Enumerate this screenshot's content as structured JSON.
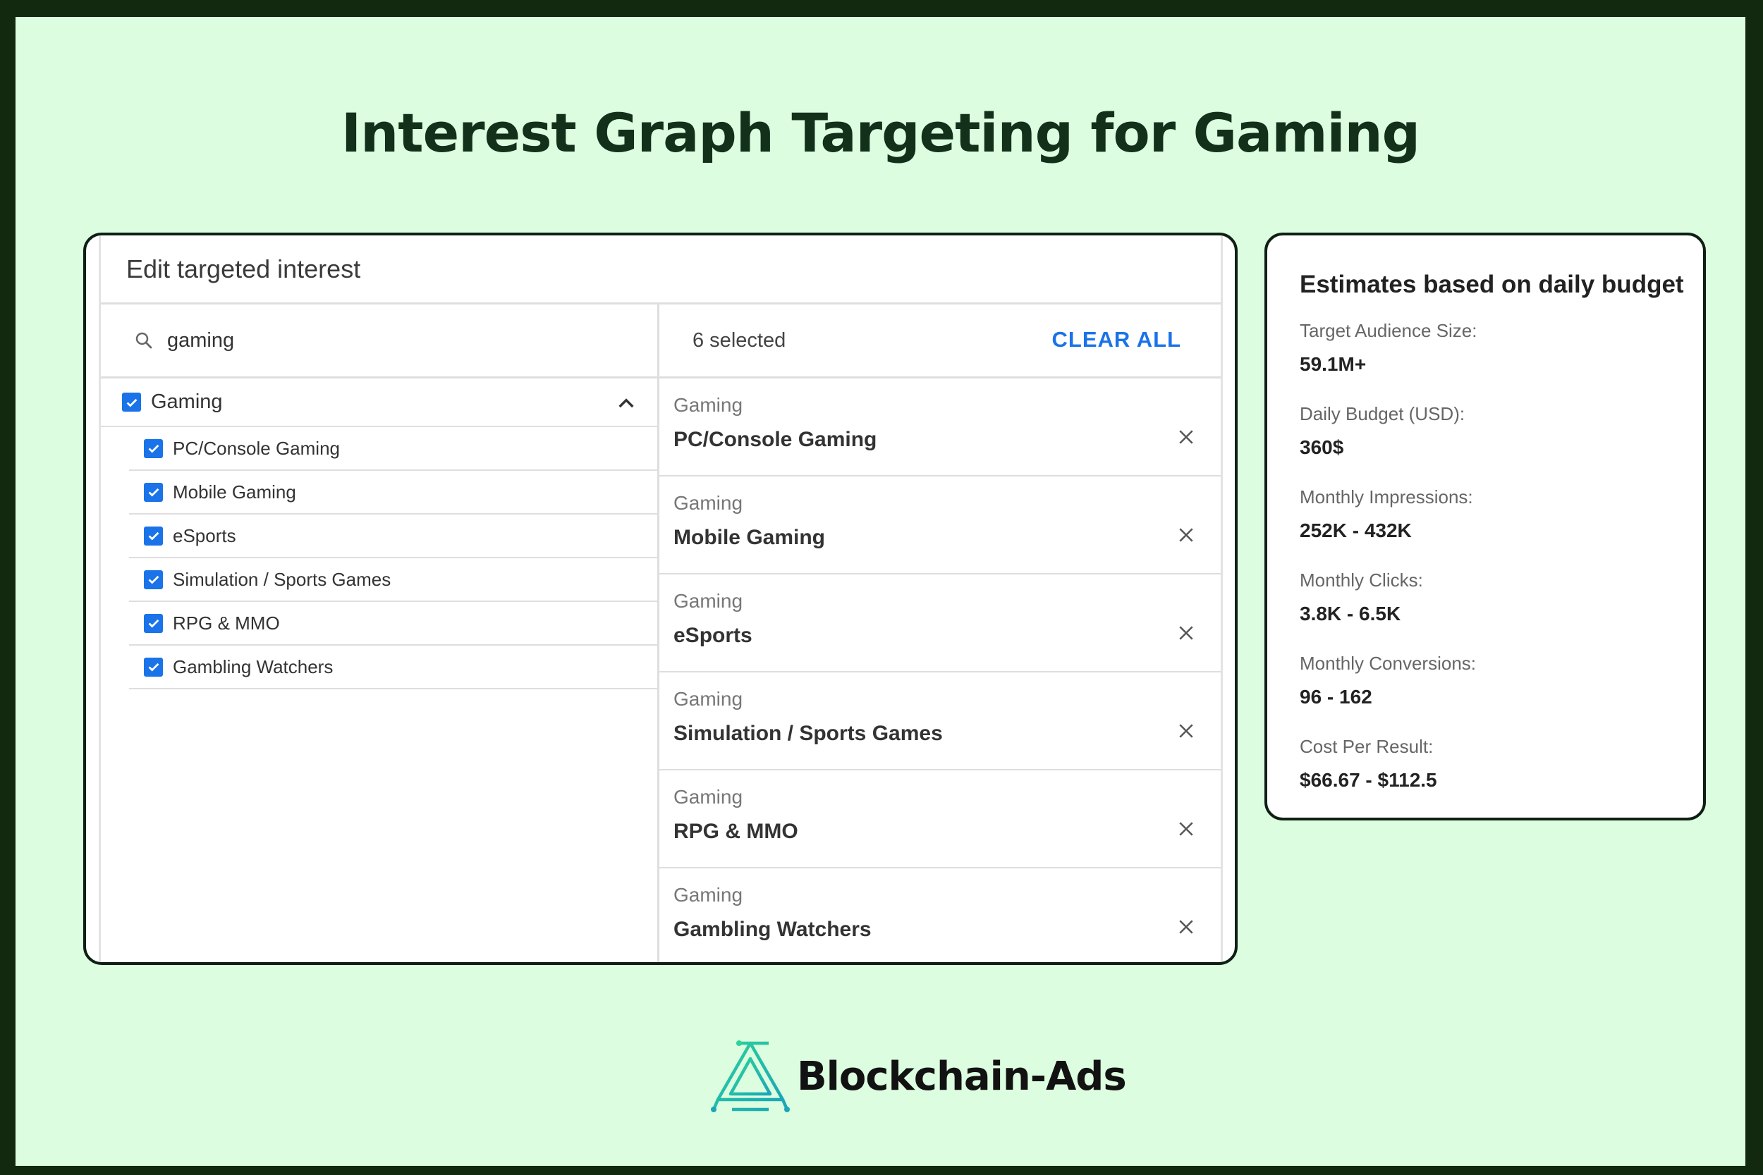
{
  "title": "Interest Graph Targeting for Gaming",
  "panel": {
    "header": "Edit targeted interest",
    "search": {
      "value": "gaming",
      "icon": "search-icon"
    },
    "tree": {
      "parent": {
        "label": "Gaming",
        "checked": true,
        "expanded": true
      },
      "children": [
        {
          "label": "PC/Console Gaming",
          "checked": true
        },
        {
          "label": "Mobile Gaming",
          "checked": true
        },
        {
          "label": "eSports",
          "checked": true
        },
        {
          "label": "Simulation / Sports Games",
          "checked": true
        },
        {
          "label": "RPG & MMO",
          "checked": true
        },
        {
          "label": "Gambling Watchers",
          "checked": true
        }
      ]
    },
    "selected": {
      "count_label": "6 selected",
      "clear_label": "CLEAR ALL",
      "items": [
        {
          "category": "Gaming",
          "name": "PC/Console Gaming"
        },
        {
          "category": "Gaming",
          "name": "Mobile Gaming"
        },
        {
          "category": "Gaming",
          "name": "eSports"
        },
        {
          "category": "Gaming",
          "name": "Simulation / Sports Games"
        },
        {
          "category": "Gaming",
          "name": "RPG & MMO"
        },
        {
          "category": "Gaming",
          "name": "Gambling Watchers"
        }
      ]
    }
  },
  "estimates": {
    "title": "Estimates based on daily budget",
    "stats": [
      {
        "label": "Target Audience Size:",
        "value": "59.1M+"
      },
      {
        "label": "Daily Budget (USD):",
        "value": "360$"
      },
      {
        "label": "Monthly Impressions:",
        "value": "252K - 432K"
      },
      {
        "label": "Monthly Clicks:",
        "value": "3.8K - 6.5K"
      },
      {
        "label": "Monthly Conversions:",
        "value": "96 - 162"
      },
      {
        "label": "Cost Per Result:",
        "value": "$66.67 - $112.5"
      }
    ]
  },
  "brand": {
    "name": "Blockchain-Ads",
    "icon": "blockchain-ads-logo-icon"
  },
  "colors": {
    "accent": "#1a73e8",
    "background": "#ddfde0",
    "border": "#12290f"
  }
}
